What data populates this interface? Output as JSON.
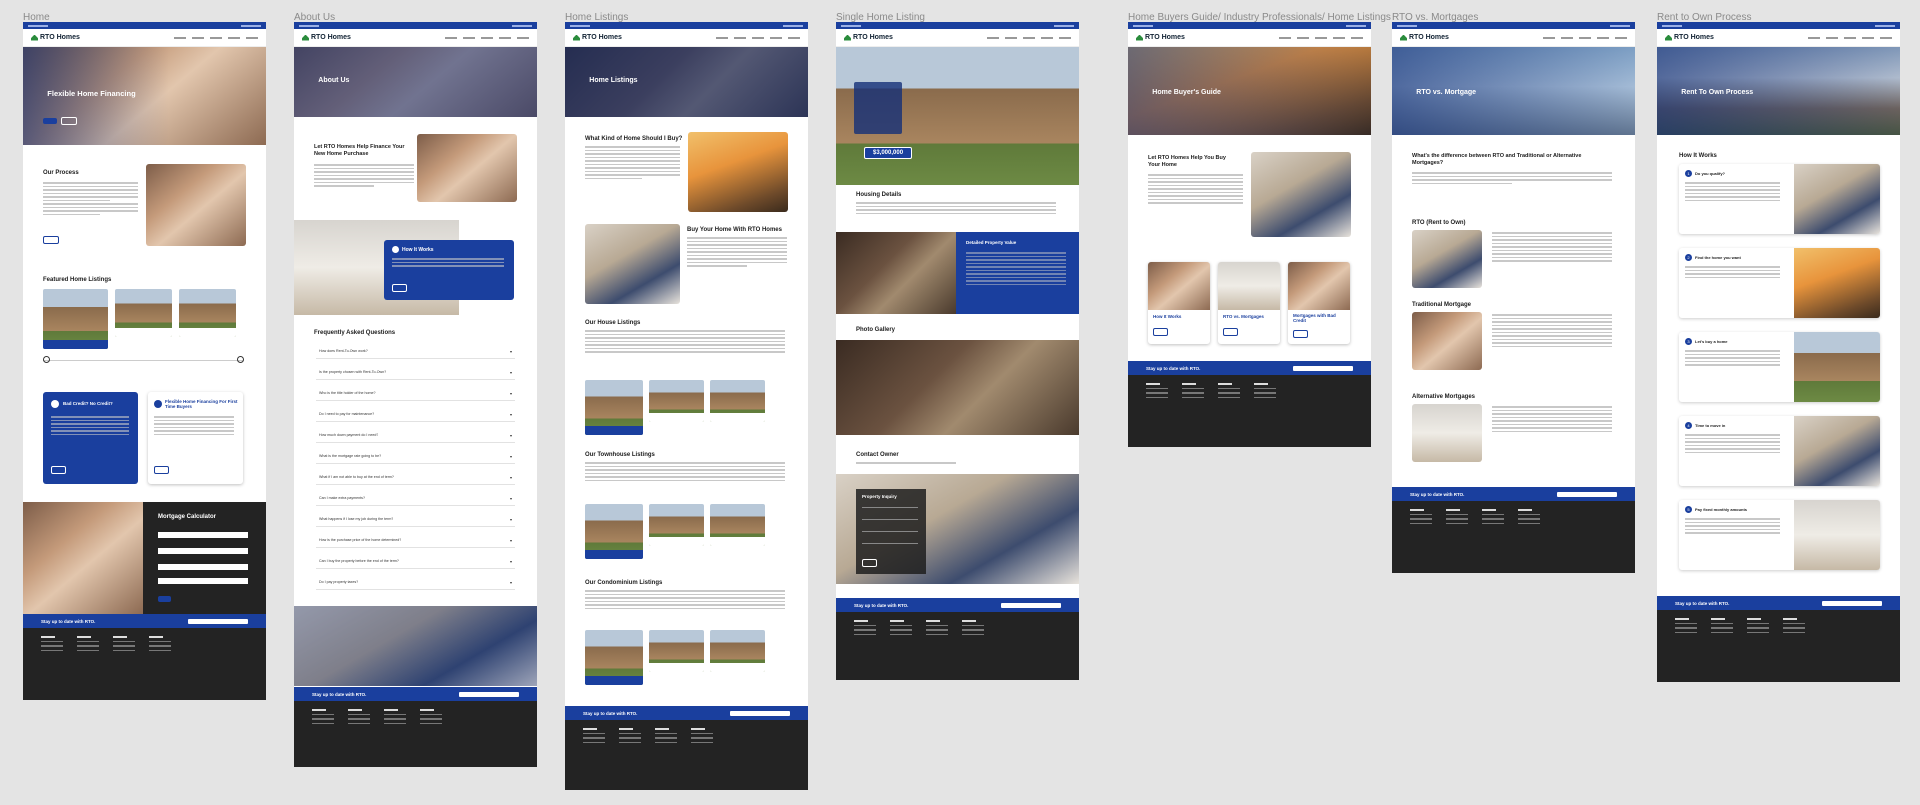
{
  "board": {
    "labels": {
      "home": "Home",
      "about": "About Us",
      "listings": "Home Listings",
      "single": "Single Home Listing",
      "guide": "Home Buyers Guide/ Industry Professionals/ Home Listings",
      "vs": "RTO vs. Mortgages",
      "process": "Rent to Own Process"
    }
  },
  "brand": {
    "logo": "RTO Homes",
    "accent": "#1a3f9e",
    "logo_mark": "#2a8c3c"
  },
  "home": {
    "hero_title": "Flexible Home Financing",
    "our_process": "Our Process",
    "featured_listings": "Featured Home Listings",
    "bad_credit": "Bad Credit? No Credit?",
    "flex_first_time": "Flexible Home Financing For First Time Buyers",
    "mortgage_calculator": "Mortgage Calculator"
  },
  "about": {
    "hero_title": "About Us",
    "help_title": "Let RTO Homes Help Finance Your New Home Purchase",
    "how_it_works": "How It Works",
    "faq_title": "Frequently Asked Questions",
    "faqs": [
      "How does Rent-To-Own work?",
      "Is the property chosen with Rent-To-Own?",
      "Who is the title holder of the home?",
      "Do I need to pay for maintenance?",
      "How much down payment do I need?",
      "What is the mortgage rate going to be?",
      "What if I am not able to buy at the end of term?",
      "Can I make extra payments?",
      "What happens if I lose my job during the term?",
      "How is the purchase price of the home determined?",
      "Can I buy the property before the end of the term?",
      "Do I pay property taxes?"
    ]
  },
  "listings": {
    "hero_title": "Home Listings",
    "what_kind": "What Kind of Home Should I Buy?",
    "buy_with": "Buy Your Home With RTO Homes",
    "house": "Our House Listings",
    "townhouse": "Our Townhouse Listings",
    "condo": "Our Condominium Listings"
  },
  "single": {
    "price": "$3,000,000",
    "housing_details": "Housing Details",
    "detailed_value": "Detailed Property Value",
    "photo_gallery": "Photo Gallery",
    "contact_owner": "Contact Owner",
    "property_inquiry": "Property Inquiry"
  },
  "guide": {
    "hero_title": "Home Buyer's Guide",
    "help_title": "Let RTO Homes Help You Buy Your Home",
    "cards": [
      "How It Works",
      "RTO vs. Mortgages",
      "Mortgages with Bad Credit"
    ]
  },
  "vs": {
    "hero_title": "RTO vs. Mortgage",
    "question": "What's the difference between RTO and Traditional or Alternative Mortgages?",
    "rto": "RTO (Rent to Own)",
    "traditional": "Traditional Mortgage",
    "alternative": "Alternative Mortgages"
  },
  "process": {
    "hero_title": "Rent To Own Process",
    "how_it_works": "How It Works",
    "steps": [
      "Do you qualify?",
      "Find the home you want",
      "Let's buy a home",
      "Time to move in",
      "Pay fixed monthly amounts"
    ]
  },
  "footer": {
    "subscribe": "Stay up to date with RTO."
  }
}
